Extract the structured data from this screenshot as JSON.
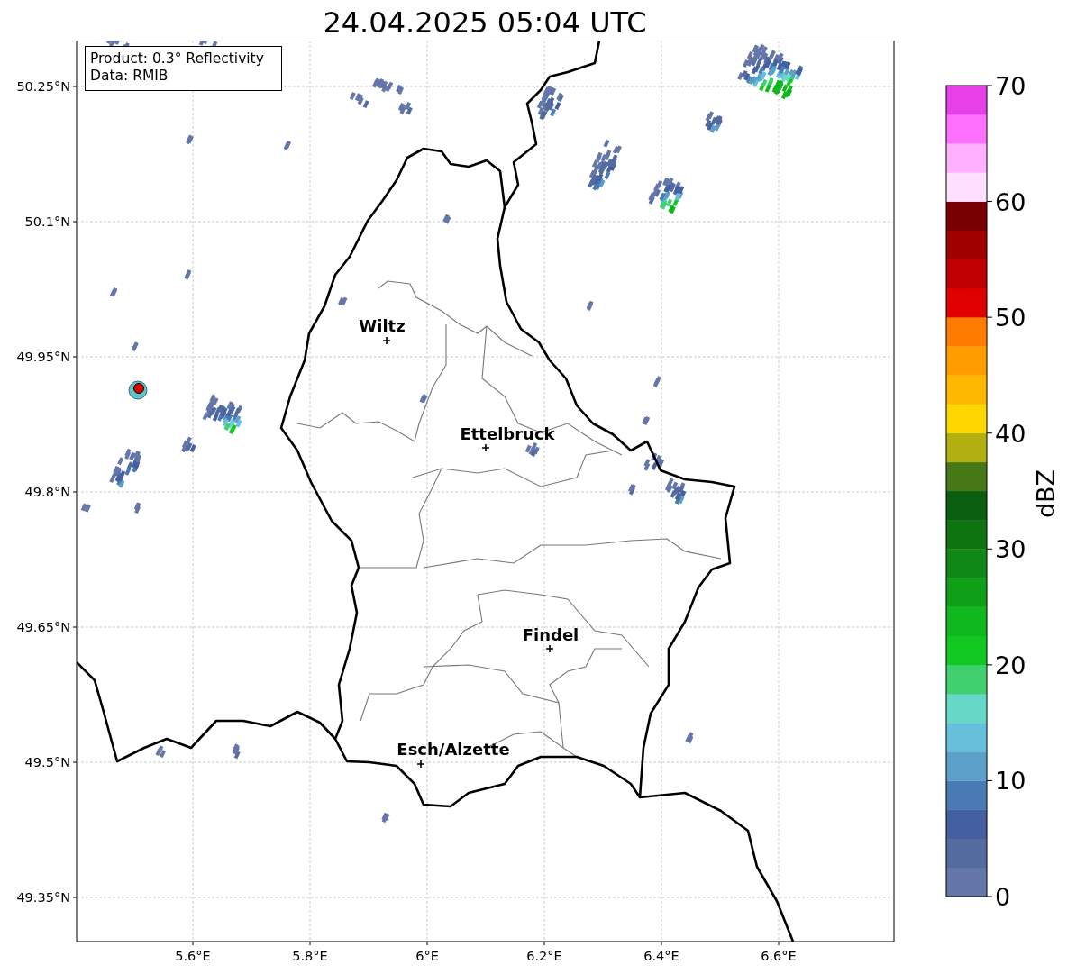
{
  "title": "24.04.2025 05:04 UTC",
  "info_lines": [
    "Product: 0.3° Reflectivity",
    "Data: RMIB"
  ],
  "lat_ticks": [
    "50.25°N",
    "50.1°N",
    "49.95°N",
    "49.8°N",
    "49.65°N",
    "49.5°N",
    "49.35°N"
  ],
  "lon_ticks": [
    "5.6°E",
    "5.8°E",
    "6°E",
    "6.2°E",
    "6.4°E",
    "6.6°E"
  ],
  "cities": [
    {
      "name": "Wiltz"
    },
    {
      "name": "Ettelbruck"
    },
    {
      "name": "Findel"
    },
    {
      "name": "Esch/Alzette"
    }
  ],
  "colorbar": {
    "label": "dBZ",
    "ticks": [
      "70",
      "60",
      "50",
      "40",
      "30",
      "20",
      "10",
      "0"
    ],
    "bins": [
      {
        "color": "#6577a8"
      },
      {
        "color": "#546ba0"
      },
      {
        "color": "#4560a0"
      },
      {
        "color": "#4a7ab5"
      },
      {
        "color": "#5aa0c8"
      },
      {
        "color": "#66c0dc"
      },
      {
        "color": "#66d8c8"
      },
      {
        "color": "#40d070"
      },
      {
        "color": "#10c820"
      },
      {
        "color": "#10b820"
      },
      {
        "color": "#10a018"
      },
      {
        "color": "#108818"
      },
      {
        "color": "#0e7410"
      },
      {
        "color": "#0a5e10"
      },
      {
        "color": "#467818"
      },
      {
        "color": "#b0b010"
      },
      {
        "color": "#ffd700"
      },
      {
        "color": "#ffb800"
      },
      {
        "color": "#ff9c00"
      },
      {
        "color": "#ff7c00"
      },
      {
        "color": "#e00000"
      },
      {
        "color": "#c00000"
      },
      {
        "color": "#a00000"
      },
      {
        "color": "#780000"
      },
      {
        "color": "#ffe0ff"
      },
      {
        "color": "#ffb0ff"
      },
      {
        "color": "#ff70ff"
      },
      {
        "color": "#e840e8"
      }
    ]
  }
}
